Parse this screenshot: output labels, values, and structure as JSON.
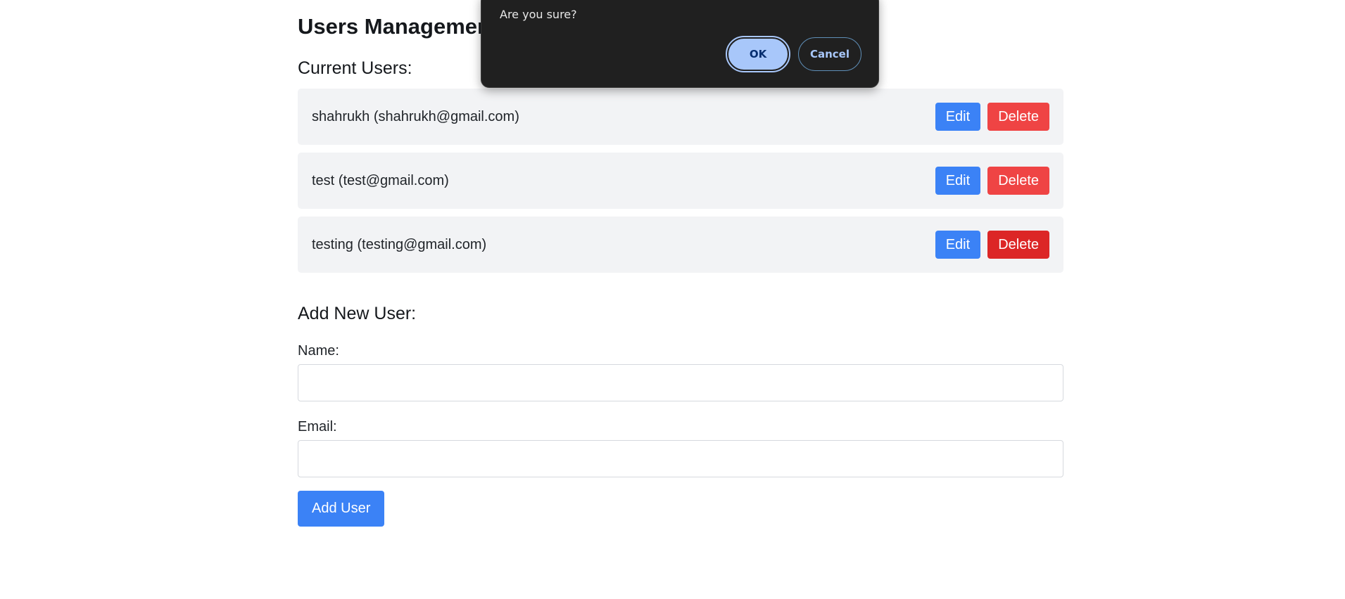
{
  "page": {
    "title": "Users Management",
    "current_users_heading": "Current Users:",
    "add_user_heading": "Add New User:"
  },
  "users": [
    {
      "text": "shahrukh (shahrukh@gmail.com)",
      "edit_label": "Edit",
      "delete_label": "Delete"
    },
    {
      "text": "test (test@gmail.com)",
      "edit_label": "Edit",
      "delete_label": "Delete"
    },
    {
      "text": "testing (testing@gmail.com)",
      "edit_label": "Edit",
      "delete_label": "Delete"
    }
  ],
  "form": {
    "name_label": "Name:",
    "name_value": "",
    "email_label": "Email:",
    "email_value": "",
    "submit_label": "Add User"
  },
  "dialog": {
    "message": "Are you sure?",
    "ok_label": "OK",
    "cancel_label": "Cancel"
  },
  "colors": {
    "primary": "#3b82f6",
    "danger": "#ef4444",
    "danger_hover": "#dc2626",
    "row_background": "#f2f3f5",
    "dialog_background": "#202020",
    "dialog_accent": "#a8c7fa"
  }
}
